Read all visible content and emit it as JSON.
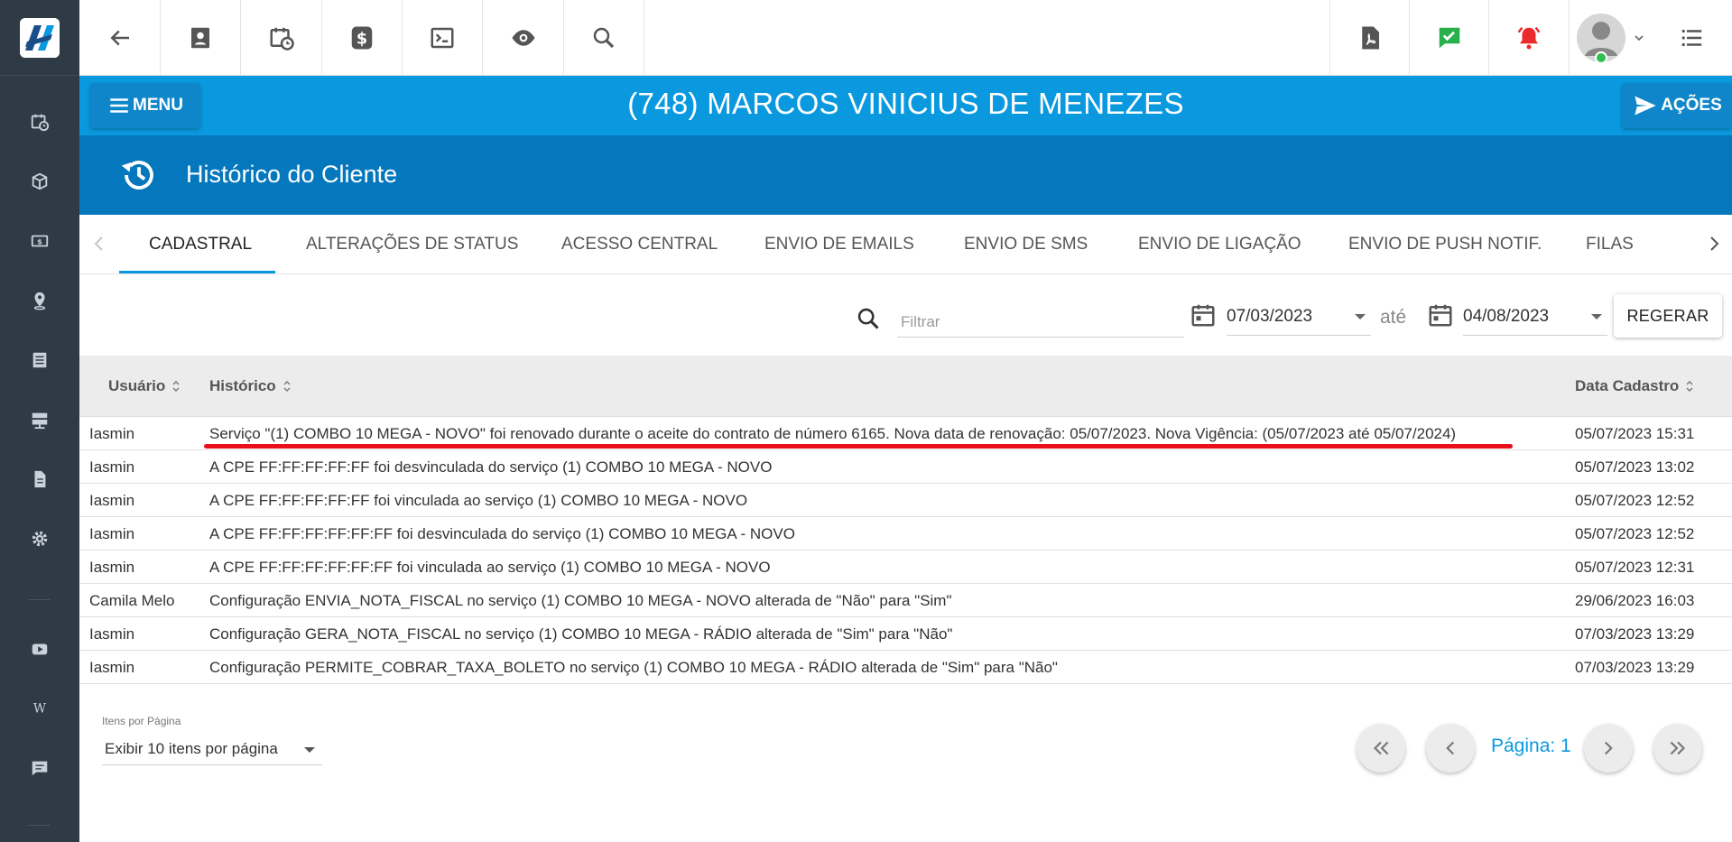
{
  "colors": {
    "sidebar": "#2f3a47",
    "accent": "#0a99df",
    "header_dark": "#0577bd",
    "highlight": "#e8101a"
  },
  "sidebar": {
    "icons": [
      "calendar-clock-icon",
      "package-icon",
      "money-icon",
      "location-icon",
      "list-icon",
      "server-icon",
      "document-icon",
      "gear-icon",
      "video-icon",
      "wiki-icon",
      "chat-icon"
    ]
  },
  "toolbar": {
    "left_icons": [
      "back-arrow-icon",
      "contact-card-icon",
      "calendar-clock-icon",
      "dollar-icon",
      "terminal-icon",
      "eye-icon",
      "search-icon"
    ],
    "right_icons": [
      "pdf-icon",
      "check-message-icon",
      "alarm-bell-icon",
      "avatar",
      "list-menu-icon"
    ]
  },
  "header": {
    "menu_label": "MENU",
    "customer_title": "(748) MARCOS VINICIUS DE MENEZES",
    "acoes_label": "AÇÕES"
  },
  "page": {
    "title": "Histórico do Cliente"
  },
  "tabs": [
    {
      "label": "CADASTRAL",
      "active": true
    },
    {
      "label": "ALTERAÇÕES DE STATUS"
    },
    {
      "label": "ACESSO CENTRAL"
    },
    {
      "label": "ENVIO DE EMAILS"
    },
    {
      "label": "ENVIO DE SMS"
    },
    {
      "label": "ENVIO DE LIGAÇÃO"
    },
    {
      "label": "ENVIO DE PUSH NOTIF."
    },
    {
      "label": "FILAS"
    }
  ],
  "filters": {
    "search_placeholder": "Filtrar",
    "date_from": "07/03/2023",
    "ate_label": "até",
    "date_to": "04/08/2023",
    "regerar_label": "REGERAR"
  },
  "table": {
    "columns": {
      "user": "Usuário",
      "history": "Histórico",
      "date": "Data Cadastro"
    },
    "rows": [
      {
        "user": "Iasmin",
        "history": "Serviço \"(1) COMBO 10 MEGA - NOVO\" foi renovado durante o aceite do contrato de número 6165. Nova data de renovação: 05/07/2023. Nova Vigência: (05/07/2023 até 05/07/2024)",
        "date": "05/07/2023 15:31"
      },
      {
        "user": "Iasmin",
        "history": "A CPE FF:FF:FF:FF:FF foi desvinculada do serviço (1) COMBO 10 MEGA - NOVO",
        "date": "05/07/2023 13:02"
      },
      {
        "user": "Iasmin",
        "history": "A CPE FF:FF:FF:FF:FF foi vinculada ao serviço (1) COMBO 10 MEGA - NOVO",
        "date": "05/07/2023 12:52"
      },
      {
        "user": "Iasmin",
        "history": "A CPE FF:FF:FF:FF:FF:FF foi desvinculada do serviço (1) COMBO 10 MEGA - NOVO",
        "date": "05/07/2023 12:52"
      },
      {
        "user": "Iasmin",
        "history": "A CPE FF:FF:FF:FF:FF:FF foi vinculada ao serviço (1) COMBO 10 MEGA - NOVO",
        "date": "05/07/2023 12:31"
      },
      {
        "user": "Camila Melo",
        "history": "Configuração ENVIA_NOTA_FISCAL no serviço (1) COMBO 10 MEGA - NOVO alterada de \"Não\" para \"Sim\"",
        "date": "29/06/2023 16:03"
      },
      {
        "user": "Iasmin",
        "history": "Configuração GERA_NOTA_FISCAL no serviço (1) COMBO 10 MEGA - RÁDIO alterada de \"Sim\" para \"Não\"",
        "date": "07/03/2023 13:29"
      },
      {
        "user": "Iasmin",
        "history": "Configuração PERMITE_COBRAR_TAXA_BOLETO no serviço (1) COMBO 10 MEGA - RÁDIO alterada de \"Sim\" para \"Não\"",
        "date": "07/03/2023 13:29"
      }
    ]
  },
  "pagination": {
    "per_page_label": "Itens por Página",
    "per_page_value": "Exibir 10 itens por página",
    "page_label": "Página: 1"
  }
}
